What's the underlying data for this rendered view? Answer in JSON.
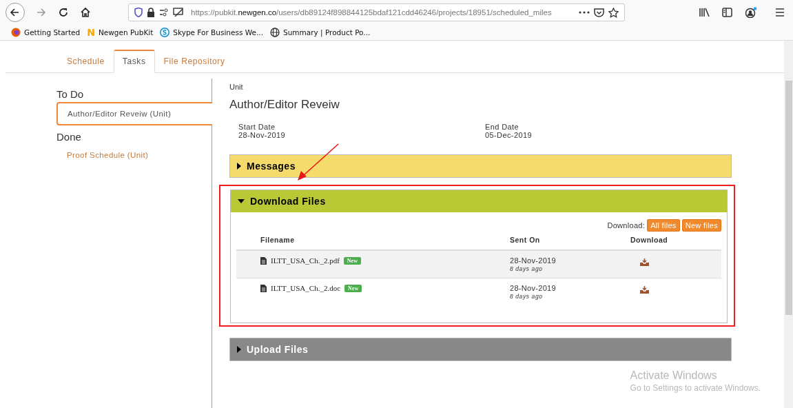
{
  "browser": {
    "url_parts": [
      "https://pubkit.",
      "newgen.co",
      "/users/db89124f898844125bdaf121cdd46246/projects/18951/scheduled_miles"
    ],
    "bookmarks": [
      {
        "kind": "firefox",
        "label": "Getting Started"
      },
      {
        "kind": "letter",
        "glyph": "N",
        "label": "Newgen PubKit"
      },
      {
        "kind": "skype",
        "label": "Skype For Business We..."
      },
      {
        "kind": "globe",
        "label": "Summary | Product Po..."
      }
    ]
  },
  "tabs": [
    {
      "label": "Schedule",
      "selected": false
    },
    {
      "label": "Tasks",
      "selected": true
    },
    {
      "label": "File Repository",
      "selected": false
    }
  ],
  "sidebar": {
    "groups": [
      {
        "heading": "To Do",
        "items": [
          {
            "label": "Author/Editor Reveiw (Unit)",
            "selected": true
          }
        ]
      },
      {
        "heading": "Done",
        "items": [
          {
            "label": "Proof Schedule (Unit)",
            "selected": false
          }
        ]
      }
    ]
  },
  "task": {
    "unit_label": "Unit",
    "title": "Author/Editor Reveiw",
    "dates": [
      {
        "label": "Start Date",
        "value": "28-Nov-2019"
      },
      {
        "label": "End Date",
        "value": "05-Dec-2019"
      }
    ]
  },
  "sections": [
    {
      "title": "Messages",
      "expanded": false,
      "highlighted": false,
      "color": "#f5db6b"
    },
    {
      "title": "Download Files",
      "expanded": true,
      "highlighted": true,
      "color": "#b9c935",
      "download_label": "Download:",
      "buttons": [
        "All files",
        "New files"
      ],
      "columns": [
        "Filename",
        "Sent On",
        "Download"
      ],
      "files": [
        {
          "name": "ILTT_USA_Ch._2.pdf",
          "badge": "New",
          "date": "28-Nov-2019",
          "ago": "8 days ago"
        },
        {
          "name": "ILTT_USA_Ch._2.doc",
          "badge": "New",
          "date": "28-Nov-2019",
          "ago": "8 days ago"
        }
      ]
    },
    {
      "title": "Upload Files",
      "expanded": false,
      "highlighted": false,
      "color": "#888888"
    }
  ],
  "os_notice": {
    "title": "Activate Windows",
    "text": "Go to Settings to activate Windows."
  }
}
